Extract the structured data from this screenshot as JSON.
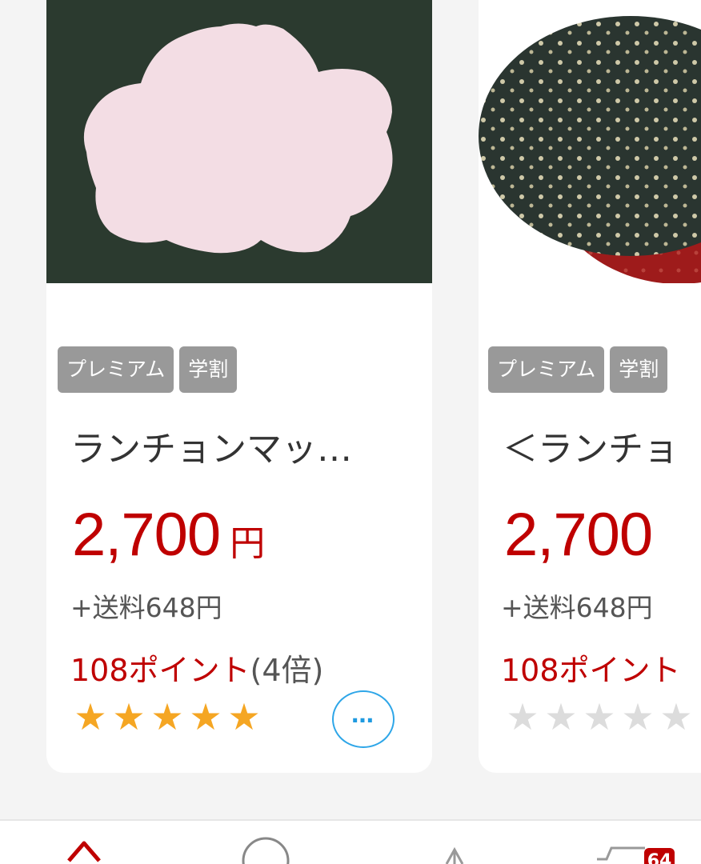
{
  "products": [
    {
      "badges": [
        "プレミアム",
        "学割"
      ],
      "title": "ランチョンマッ…",
      "price": "2,700",
      "currency": "円",
      "shipping": "+送料648円",
      "points": "108ポイント",
      "points_multiplier": "(4倍)",
      "rating_stars": 5,
      "more_button": "…"
    },
    {
      "badges": [
        "プレミアム",
        "学割"
      ],
      "title": "＜ランチョ",
      "price": "2,700",
      "shipping": "+送料648円",
      "points": "108ポイント",
      "rating_stars": 0
    }
  ],
  "bottom_nav": {
    "items": [
      "home-icon",
      "search-icon",
      "notification-icon",
      "cart-icon"
    ],
    "cart_badge": "64"
  },
  "colors": {
    "price_red": "#bf0000",
    "badge_gray": "#999999",
    "star_orange": "#f5a623",
    "more_blue": "#2ea6e8"
  }
}
